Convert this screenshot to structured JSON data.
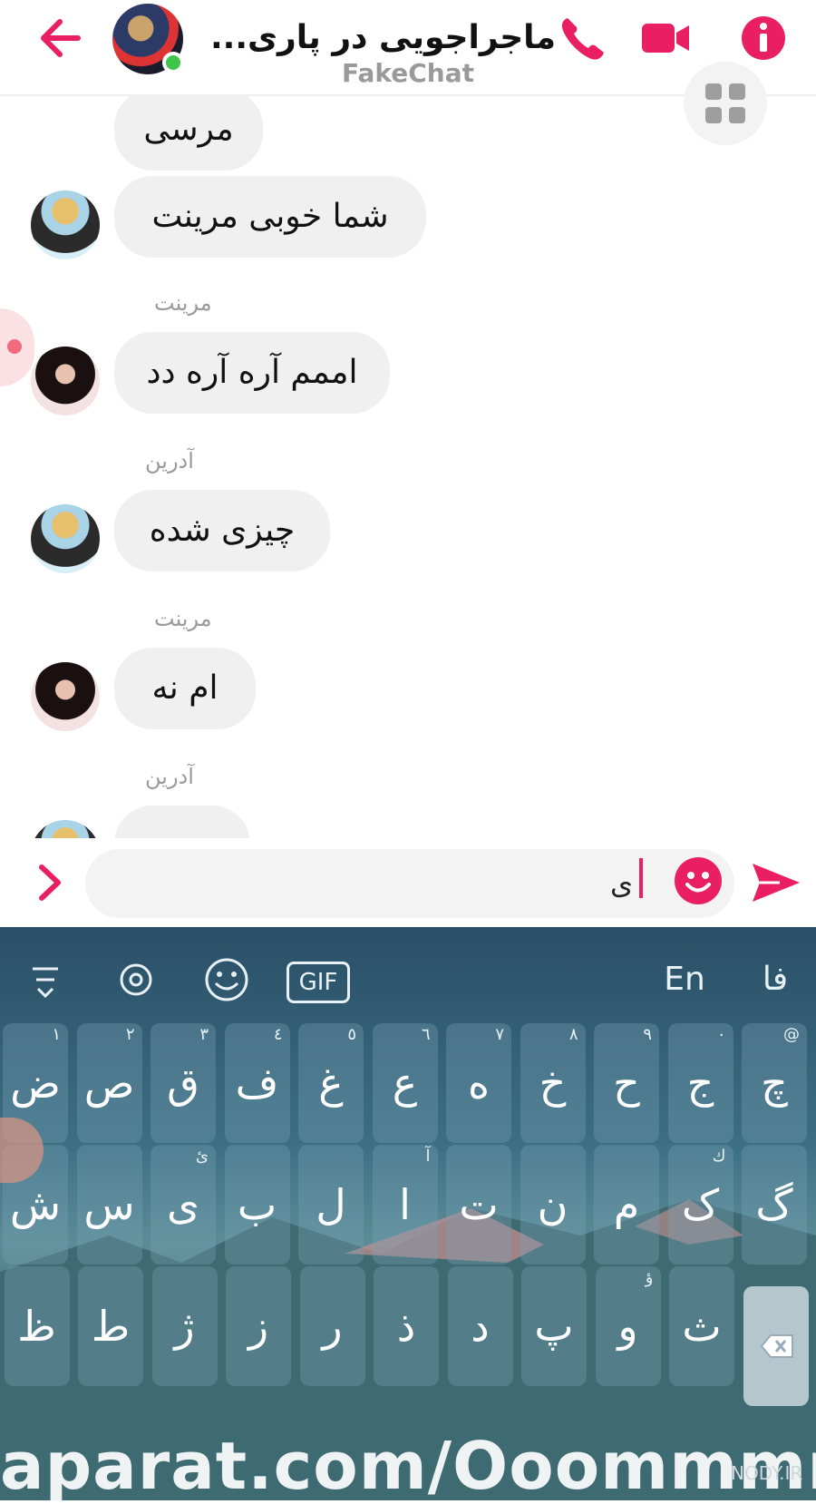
{
  "header": {
    "title": "ماجراجویی در پاری...",
    "subtitle": "FakeChat"
  },
  "colors": {
    "accent": "#e91e63",
    "bubble": "#f0f0f0",
    "online": "#3fc54a"
  },
  "messages": [
    {
      "text": "مرسی"
    },
    {
      "text": "شما خوبی مرینت"
    },
    {
      "sender": "مرینت",
      "text": "اممم آره آره دد"
    },
    {
      "sender": "آدرین",
      "text": "چیزی شده"
    },
    {
      "sender": "مرینت",
      "text": "ام نه"
    },
    {
      "sender": "آدرین"
    }
  ],
  "composer": {
    "value": "ی"
  },
  "keyboard": {
    "lang_en": "En",
    "lang_fa": "فا",
    "gif_label": "GIF",
    "row1": [
      {
        "key": "چ",
        "hint": "@"
      },
      {
        "key": "ج",
        "hint": "٠"
      },
      {
        "key": "ح",
        "hint": "٩"
      },
      {
        "key": "خ",
        "hint": "٨"
      },
      {
        "key": "ه",
        "hint": "٧"
      },
      {
        "key": "ع",
        "hint": "٦"
      },
      {
        "key": "غ",
        "hint": "٥"
      },
      {
        "key": "ف",
        "hint": "٤"
      },
      {
        "key": "ق",
        "hint": "٣"
      },
      {
        "key": "ص",
        "hint": "٢"
      },
      {
        "key": "ض",
        "hint": "١"
      }
    ],
    "row2": [
      {
        "key": "گ",
        "hint": ""
      },
      {
        "key": "ک",
        "hint": "ك"
      },
      {
        "key": "م",
        "hint": ""
      },
      {
        "key": "ن",
        "hint": ""
      },
      {
        "key": "ت",
        "hint": ""
      },
      {
        "key": "ا",
        "hint": "آ"
      },
      {
        "key": "ل",
        "hint": ""
      },
      {
        "key": "ب",
        "hint": ""
      },
      {
        "key": "ی",
        "hint": "ئ"
      },
      {
        "key": "س",
        "hint": ""
      },
      {
        "key": "ش",
        "hint": ""
      }
    ],
    "row3": [
      {
        "key": "ث",
        "hint": ""
      },
      {
        "key": "و",
        "hint": "ؤ"
      },
      {
        "key": "پ",
        "hint": ""
      },
      {
        "key": "د",
        "hint": ""
      },
      {
        "key": "ذ",
        "hint": ""
      },
      {
        "key": "ر",
        "hint": ""
      },
      {
        "key": "ز",
        "hint": ""
      },
      {
        "key": "ژ",
        "hint": ""
      },
      {
        "key": "ط",
        "hint": ""
      },
      {
        "key": "ظ",
        "hint": ""
      }
    ]
  },
  "watermark": {
    "text": "aparat.com/Ooommmn",
    "site": "NODY.IR"
  }
}
